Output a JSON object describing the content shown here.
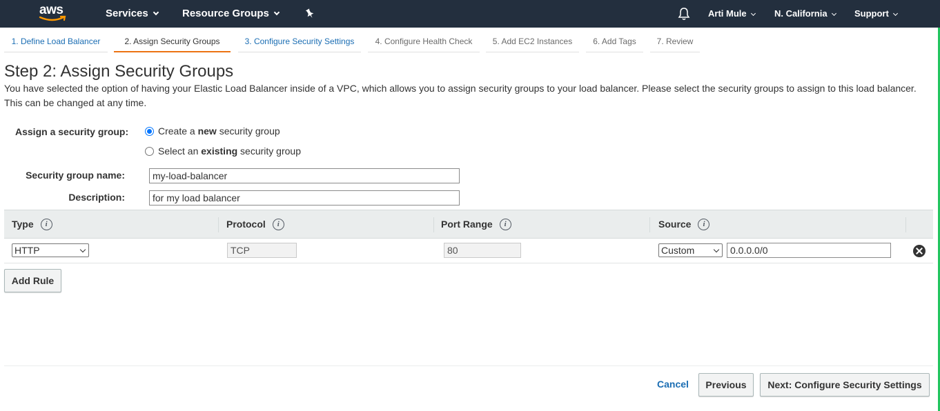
{
  "nav": {
    "logo_text": "aws",
    "services": "Services",
    "resource_groups": "Resource Groups",
    "user": "Arti Mule",
    "region": "N. California",
    "support": "Support",
    "bg_color": "#232f3e"
  },
  "tabs": [
    {
      "label": "1. Define Load Balancer",
      "state": "link"
    },
    {
      "label": "2. Assign Security Groups",
      "state": "active"
    },
    {
      "label": "3. Configure Security Settings",
      "state": "link"
    },
    {
      "label": "4. Configure Health Check",
      "state": "muted"
    },
    {
      "label": "5. Add EC2 Instances",
      "state": "muted"
    },
    {
      "label": "6. Add Tags",
      "state": "muted"
    },
    {
      "label": "7. Review",
      "state": "muted"
    }
  ],
  "step": {
    "title": "Step 2: Assign Security Groups",
    "description": "You have selected the option of having your Elastic Load Balancer inside of a VPC, which allows you to assign security groups to your load balancer. Please select the security groups to assign to this load balancer. This can be changed at any time."
  },
  "form": {
    "assign_label": "Assign a security group:",
    "option_create_pre": "Create a ",
    "option_create_bold": "new",
    "option_create_post": " security group",
    "option_existing_pre": "Select an ",
    "option_existing_bold": "existing",
    "option_existing_post": " security group",
    "selected_option": "create",
    "name_label": "Security group name:",
    "name_value": "my-load-balancer",
    "desc_label": "Description:",
    "desc_value": "for my load balancer"
  },
  "rules": {
    "headers": {
      "type": "Type",
      "protocol": "Protocol",
      "port_range": "Port Range",
      "source": "Source"
    },
    "rows": [
      {
        "type": "HTTP",
        "protocol": "TCP",
        "port_range": "80",
        "source_type": "Custom",
        "source_value": "0.0.0.0/0"
      }
    ],
    "add_rule": "Add Rule"
  },
  "footer": {
    "cancel": "Cancel",
    "previous": "Previous",
    "next": "Next: Configure Security Settings"
  },
  "colors": {
    "accent": "#ec7211",
    "link": "#1a6db3"
  }
}
